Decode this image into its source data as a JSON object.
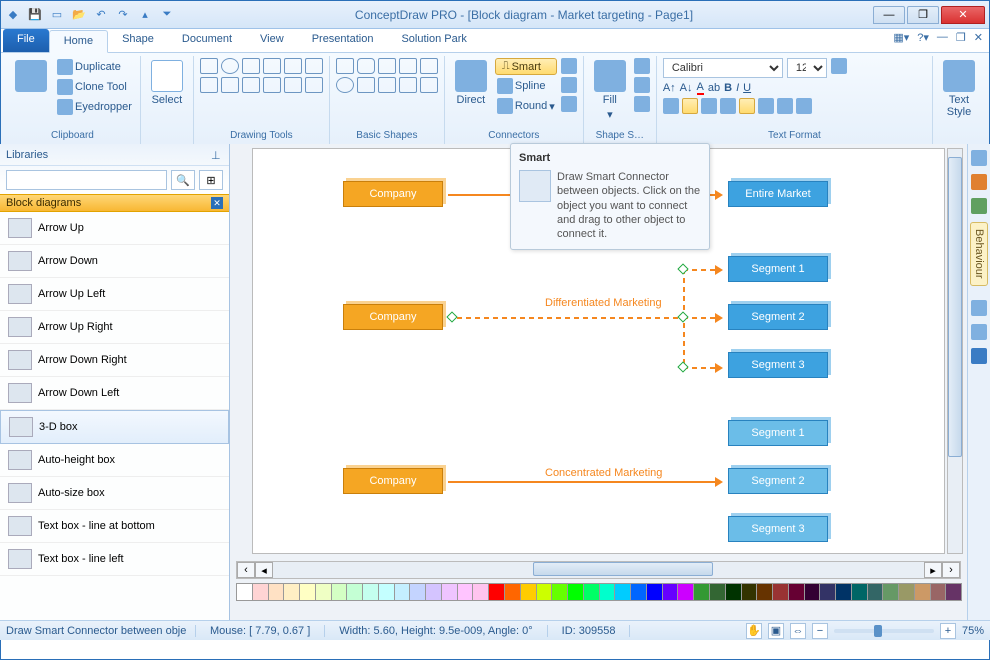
{
  "window": {
    "title": "ConceptDraw PRO - [Block diagram - Market targeting - Page1]"
  },
  "tabs": {
    "file": "File",
    "items": [
      "Home",
      "Shape",
      "Document",
      "View",
      "Presentation",
      "Solution Park"
    ],
    "active": 0
  },
  "ribbon": {
    "clipboard": {
      "label": "Clipboard",
      "duplicate": "Duplicate",
      "clone": "Clone Tool",
      "eyedropper": "Eyedropper"
    },
    "select": "Select",
    "drawing": "Drawing Tools",
    "shapes": "Basic Shapes",
    "connectors": {
      "label": "Connectors",
      "direct": "Direct",
      "smart": "Smart",
      "spline": "Spline",
      "round": "Round"
    },
    "fill": "Fill",
    "shapeStyle": "Shape S…",
    "font": {
      "name": "Calibri",
      "size": "12"
    },
    "textFormat": "Text Format",
    "textStyle": "Text\nStyle"
  },
  "libraries": {
    "header": "Libraries",
    "category": "Block diagrams",
    "items": [
      "Arrow Up",
      "Arrow Down",
      "Arrow Up Left",
      "Arrow Up Right",
      "Arrow Down Right",
      "Arrow Down Left",
      "3-D box",
      "Auto-height box",
      "Auto-size box",
      "Text box - line at bottom",
      "Text box - line left"
    ],
    "selected": 6
  },
  "canvas": {
    "companies": [
      "Company",
      "Company",
      "Company"
    ],
    "entire": "Entire Market",
    "segments1": [
      "Segment 1",
      "Segment 2",
      "Segment 3"
    ],
    "segments2": [
      "Segment 1",
      "Segment 2",
      "Segment 3"
    ],
    "diffLabel": "Differentiated Marketing",
    "concLabel": "Concentrated Marketing"
  },
  "tooltip": {
    "title": "Smart",
    "body": "Draw Smart Connector between objects. Click on the object you want to connect and drag to other object to connect it."
  },
  "behaviour": "Behaviour",
  "palette": [
    "#ffffff",
    "#ffd4d4",
    "#ffe1c4",
    "#ffefc4",
    "#ffffc4",
    "#efffc4",
    "#d4ffc4",
    "#c4ffd4",
    "#c4ffef",
    "#c4ffff",
    "#c4efff",
    "#c4d4ff",
    "#d4c4ff",
    "#efc4ff",
    "#ffc4ff",
    "#ffc4ef",
    "#ff0000",
    "#ff6600",
    "#ffcc00",
    "#ccff00",
    "#66ff00",
    "#00ff00",
    "#00ff66",
    "#00ffcc",
    "#00ccff",
    "#0066ff",
    "#0000ff",
    "#6600ff",
    "#cc00ff",
    "#339933",
    "#336633",
    "#003300",
    "#333300",
    "#663300",
    "#993333",
    "#660033",
    "#330033",
    "#333366",
    "#003366",
    "#006666",
    "#336666",
    "#669966",
    "#999966",
    "#cc9966",
    "#996666",
    "#663366"
  ],
  "status": {
    "hint": "Draw Smart Connector between obje",
    "mouse": "Mouse: [ 7.79, 0.67 ]",
    "dims": "Width: 5.60,  Height: 9.5e-009,  Angle: 0°",
    "id": "ID: 309558",
    "zoom": "75%"
  }
}
